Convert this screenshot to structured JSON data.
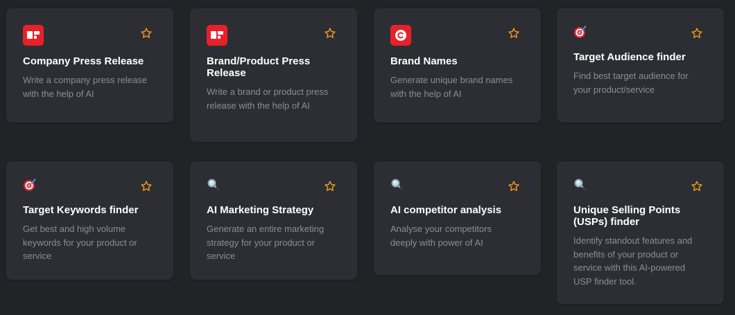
{
  "colors": {
    "background": "#222326",
    "card": "#2d2e33",
    "title": "#ffffff",
    "description": "#8b8e97",
    "star": "#f39c1c",
    "icon_red": "#e8202a"
  },
  "cards": [
    {
      "icon": "newspaper-icon",
      "title": "Company Press Release",
      "description": "Write a company press release with the help of AI"
    },
    {
      "icon": "newspaper-icon",
      "title": "Brand/Product Press Release",
      "description": "Write a brand or product press release with the help of AI"
    },
    {
      "icon": "copyright-icon",
      "title": "Brand Names",
      "description": "Generate unique brand names with the help of AI"
    },
    {
      "icon": "target-icon",
      "title": "Target Audience finder",
      "description": "Find best target audience for your product/service"
    },
    {
      "icon": "target-icon",
      "title": "Target Keywords finder",
      "description": "Get best and high volume keywords for your product or service"
    },
    {
      "icon": "magnifier-icon",
      "title": "AI Marketing Strategy",
      "description": "Generate an entire marketing strategy for your product or service"
    },
    {
      "icon": "magnifier-icon",
      "title": "AI competitor analysis",
      "description": "Analyse your competitors deeply with power of AI"
    },
    {
      "icon": "magnifier-icon",
      "title": "Unique Selling Points (USPs) finder",
      "description": "Identify standout features and benefits of your product or service with this AI-powered USP finder tool."
    }
  ]
}
